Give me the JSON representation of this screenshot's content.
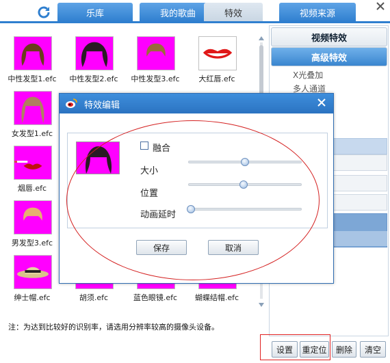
{
  "tabs": [
    {
      "label": "乐库"
    },
    {
      "label": "我的歌曲"
    },
    {
      "label": "特效"
    },
    {
      "label": "视频来源"
    }
  ],
  "active_tab": "特效",
  "grid": {
    "items": [
      {
        "label": "中性发型1.efc",
        "icon": "hair-neutral-icon"
      },
      {
        "label": "中性发型2.efc",
        "icon": "hair-dark-icon"
      },
      {
        "label": "中性发型3.efc",
        "icon": "hair-light-icon"
      },
      {
        "label": "大红唇.efc",
        "icon": "red-lips-icon"
      },
      {
        "label": "女发型1.efc",
        "icon": "hair-female-icon"
      },
      {
        "label": "烟唇.efc",
        "icon": "smoking-lips-icon"
      },
      {
        "label": "男发型3.efc",
        "icon": "hair-male-icon"
      },
      {
        "label": "绅士帽.efc",
        "icon": "gentleman-hat-icon"
      },
      {
        "label": "胡须.efc",
        "icon": "beard-icon"
      },
      {
        "label": "蓝色眼镜.efc",
        "icon": "blue-glasses-icon"
      },
      {
        "label": "蝴蝶结帽.efc",
        "icon": "bow-hat-icon"
      }
    ]
  },
  "note": "注：为达到比较好的识别率，请选用分辨率较高的摄像头设备。",
  "right_panel": {
    "video_effects": "视频特效",
    "advanced_effects": "高级特效",
    "options": [
      "X光叠加",
      "多人通道"
    ]
  },
  "bottom_buttons": {
    "settings": "设置",
    "reset": "重定位",
    "delete": "删除",
    "clear": "清空"
  },
  "dialog": {
    "title": "特效编辑",
    "blend_label": "融合",
    "blend_checked": false,
    "size_label": "大小",
    "position_label": "位置",
    "delay_label": "动画延时",
    "size_value": 0.5,
    "position_value": 0.49,
    "delay_value": 0.02,
    "save": "保存",
    "cancel": "取消"
  },
  "colors": {
    "accent": "#2f7fcf",
    "thumb_bg": "#ff00ff",
    "highlight": "#e02020"
  }
}
